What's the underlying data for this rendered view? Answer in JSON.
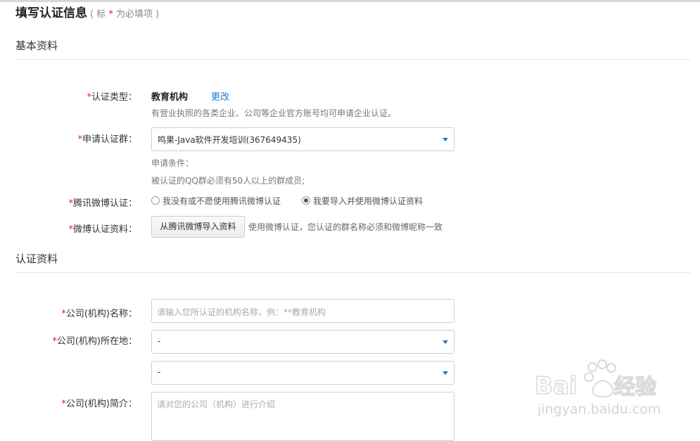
{
  "title": "填写认证信息",
  "title_hint": {
    "open": "( 标",
    "star": "*",
    "close": "为必填项 )"
  },
  "sections": {
    "basic": "基本资料",
    "cert": "认证资料"
  },
  "required_mark": "*",
  "fields": {
    "cert_type": {
      "label": "认证类型：",
      "value": "教育机构",
      "change_link": "更改",
      "desc": "有营业执照的各类企业、公司等企业官方账号均可申请企业认证。"
    },
    "group": {
      "label": "申请认证群：",
      "value": "鸣果-Java软件开发培训(367649435)",
      "cond_title": "申请条件：",
      "cond_text": "被认证的QQ群必须有50人以上的群成员;"
    },
    "weibo": {
      "label": "腾讯微博认证：",
      "options": [
        {
          "label": "我没有或不愿使用腾讯微博认证",
          "checked": false
        },
        {
          "label": "我要导入并使用微博认证资料",
          "checked": true
        }
      ]
    },
    "weibo_data": {
      "label": "微博认证资料：",
      "button": "从腾讯微博导入资料",
      "note": "使用微博认证，您认证的群名称必须和微博昵称一致"
    },
    "company_name": {
      "label": "公司(机构)名称：",
      "placeholder": "请输入您所认证的机构名称，例：**教育机构"
    },
    "company_location": {
      "label": "公司(机构)所在地：",
      "province": "-",
      "city": "-"
    },
    "company_intro": {
      "label": "公司(机构)简介：",
      "placeholder": "请对您的公司（机构）进行介绍"
    }
  },
  "watermark": {
    "brand": "Bai du 经验",
    "url": "jingyan.baidu.com"
  },
  "colors": {
    "required": "#e02020",
    "link": "#1f76c8"
  }
}
